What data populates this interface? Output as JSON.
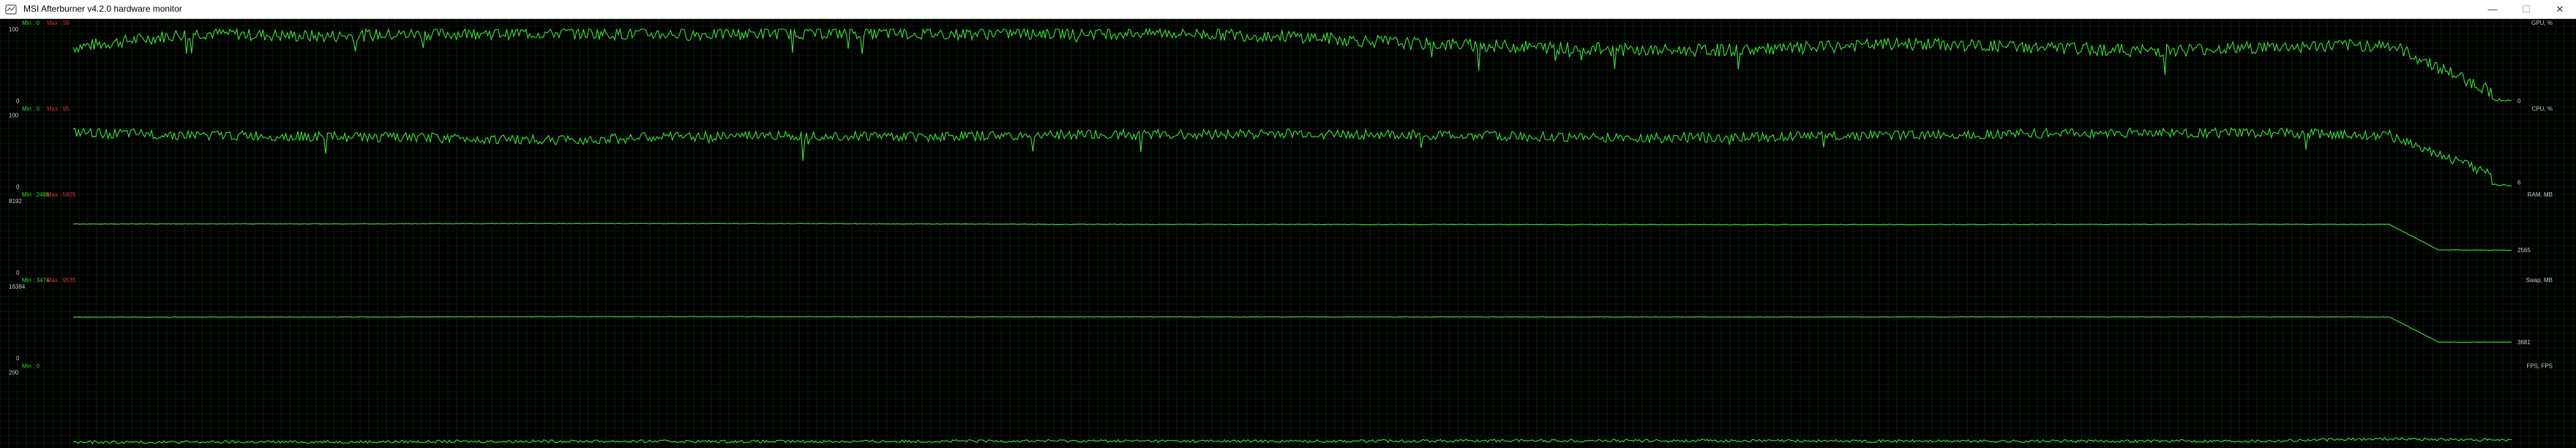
{
  "window": {
    "title": "MSI Afterburner v4.2.0 hardware monitor",
    "icon": "afterburner-app-icon",
    "controls": {
      "minimize": "—",
      "maximize": "☐",
      "close": "✕"
    }
  },
  "colors": {
    "background": "#000000",
    "grid": "#123012",
    "series": "#3ee33e",
    "series_text": "#37d637",
    "max_text": "#e03030",
    "axis_text": "#c8c8c8"
  },
  "panels": [
    {
      "name": "GPU, %",
      "min_label": "Min : 0",
      "max_label": "Max : 99",
      "top_label": "100",
      "bottom_label": "0",
      "current_value": "0",
      "ylim": [
        0,
        100
      ]
    },
    {
      "name": "CPU, %",
      "min_label": "Min : 0",
      "max_label": "Max : 95",
      "top_label": "100",
      "bottom_label": "0",
      "current_value": "6",
      "ylim": [
        0,
        100
      ]
    },
    {
      "name": "RAM, MB",
      "min_label": "Min : 2488",
      "max_label": "Max : 5825",
      "top_label": "8192",
      "bottom_label": "0",
      "current_value": "2565",
      "ylim": [
        0,
        8192
      ]
    },
    {
      "name": "Swap, MB",
      "min_label": "Min : 3474",
      "max_label": "Max : 9535",
      "top_label": "16384",
      "bottom_label": "0",
      "current_value": "3681",
      "ylim": [
        0,
        16384
      ]
    },
    {
      "name": "FPS, FPS",
      "min_label": "Min : 0",
      "max_label": "",
      "top_label": "200",
      "bottom_label": "",
      "current_value": "",
      "ylim": [
        0,
        200
      ]
    }
  ],
  "chart_data": [
    {
      "type": "line",
      "title": "GPU, %",
      "ylim": [
        0,
        100
      ],
      "x": [
        0,
        5,
        10,
        15,
        20,
        25,
        30,
        35,
        40,
        45,
        50,
        55,
        60,
        65,
        70,
        75,
        80,
        85,
        90,
        95,
        100
      ],
      "values": [
        75,
        95,
        90,
        94,
        95,
        93,
        95,
        94,
        95,
        95,
        90,
        80,
        75,
        70,
        72,
        80,
        75,
        70,
        75,
        78,
        0
      ]
    },
    {
      "type": "line",
      "title": "CPU, %",
      "ylim": [
        0,
        100
      ],
      "x": [
        0,
        5,
        10,
        15,
        20,
        25,
        30,
        35,
        40,
        45,
        50,
        55,
        60,
        65,
        70,
        75,
        80,
        85,
        90,
        95,
        100
      ],
      "values": [
        75,
        72,
        70,
        68,
        65,
        70,
        72,
        70,
        72,
        73,
        74,
        72,
        70,
        68,
        70,
        72,
        74,
        75,
        75,
        72,
        6
      ]
    },
    {
      "type": "line",
      "title": "RAM, MB",
      "ylim": [
        0,
        8192
      ],
      "x": [
        0,
        10,
        20,
        30,
        40,
        50,
        60,
        70,
        80,
        90,
        95,
        97,
        100
      ],
      "values": [
        5550,
        5560,
        5610,
        5600,
        5500,
        5480,
        5470,
        5460,
        5480,
        5500,
        5490,
        2565,
        2565
      ]
    },
    {
      "type": "line",
      "title": "Swap, MB",
      "ylim": [
        0,
        16384
      ],
      "x": [
        0,
        10,
        20,
        30,
        40,
        50,
        60,
        70,
        80,
        90,
        95,
        97,
        100
      ],
      "values": [
        9400,
        9420,
        9520,
        9500,
        9460,
        9450,
        9440,
        9430,
        9460,
        9450,
        9440,
        3681,
        3681
      ]
    },
    {
      "type": "line",
      "title": "FPS, FPS",
      "ylim": [
        0,
        200
      ],
      "x": [
        0,
        10,
        20,
        30,
        40,
        50,
        60,
        70,
        80,
        90,
        95,
        100
      ],
      "values": [
        5,
        6,
        8,
        7,
        9,
        8,
        10,
        9,
        8,
        9,
        15,
        10
      ]
    }
  ]
}
